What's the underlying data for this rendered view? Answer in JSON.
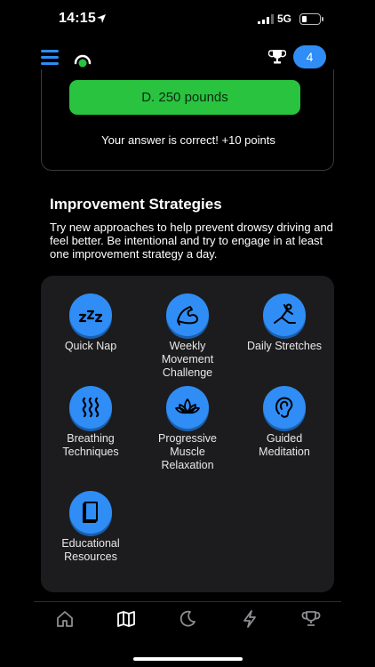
{
  "status_bar": {
    "time": "14:15",
    "network": "5G",
    "location_icon": "location-arrow-icon",
    "signal_icon": "signal-bars-icon",
    "battery_icon": "battery-low-icon"
  },
  "header": {
    "menu_icon": "hamburger-menu-icon",
    "logo_icon": "app-logo-icon",
    "trophy_icon": "trophy-icon",
    "points": "4"
  },
  "quiz": {
    "selected_answer": "D. 250 pounds",
    "feedback": "Your answer is correct! +10 points"
  },
  "improvement": {
    "title": "Improvement Strategies",
    "description": "Try new approaches to help prevent drowsy driving and feel better. Be intentional and try to engage in at least one improvement strategy a day.",
    "strategies": [
      {
        "label": "Quick Nap",
        "icon": "zzz-icon"
      },
      {
        "label": "Weekly Movement Challenge",
        "icon": "flexed-arm-icon"
      },
      {
        "label": "Daily Stretches",
        "icon": "stretch-pose-icon"
      },
      {
        "label": "Breathing Techniques",
        "icon": "breath-waves-icon"
      },
      {
        "label": "Progressive Muscle Relaxation",
        "icon": "lotus-icon"
      },
      {
        "label": "Guided Meditation",
        "icon": "ear-icon"
      },
      {
        "label": "Educational Resources",
        "icon": "book-icon"
      }
    ]
  },
  "tabbar": {
    "tabs": [
      {
        "icon": "home-icon"
      },
      {
        "icon": "map-icon"
      },
      {
        "icon": "moon-icon"
      },
      {
        "icon": "lightning-icon"
      },
      {
        "icon": "trophy-icon"
      }
    ],
    "active_index": 1
  },
  "colors": {
    "accent": "#2f8df5",
    "correct": "#29c33f",
    "panel": "#1c1c1e",
    "background": "#000000"
  }
}
